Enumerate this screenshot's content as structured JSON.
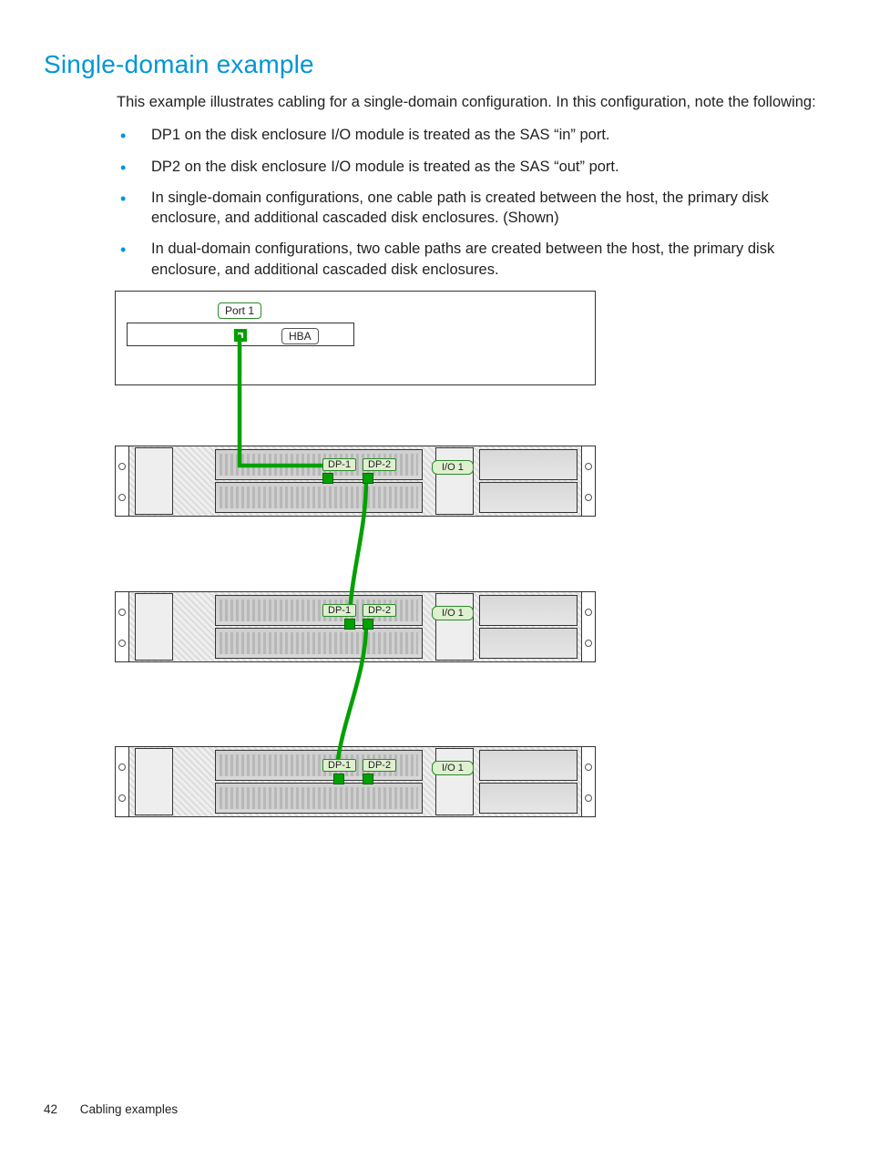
{
  "heading": "Single-domain example",
  "intro": "This example illustrates cabling for a single-domain configuration. In this configuration, note the following:",
  "bullets": [
    "DP1 on the disk enclosure I/O module is treated as the SAS “in” port.",
    "DP2 on the disk enclosure I/O module is treated as the SAS “out” port.",
    "In single-domain configurations, one cable path is created between the host, the primary disk enclosure, and additional cascaded disk enclosures. (Shown)",
    "In dual-domain configurations, two cable paths are created between the host, the primary disk enclosure, and additional cascaded disk enclosures."
  ],
  "diagram": {
    "host": {
      "port1": "Port 1",
      "hba": "HBA"
    },
    "enclosures": [
      {
        "dp1": "DP-1",
        "dp2": "DP-2",
        "io": "I/O 1"
      },
      {
        "dp1": "DP-1",
        "dp2": "DP-2",
        "io": "I/O 1"
      },
      {
        "dp1": "DP-1",
        "dp2": "DP-2",
        "io": "I/O 1"
      }
    ]
  },
  "footer": {
    "page": "42",
    "section": "Cabling examples"
  }
}
